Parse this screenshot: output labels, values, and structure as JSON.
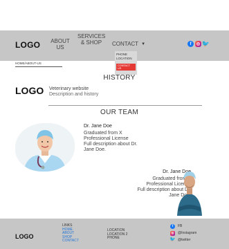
{
  "header": {
    "logo": "LOGO",
    "nav": {
      "about": "ABOUT US",
      "services": "SERVICES & SHOP",
      "contact": "CONTACT"
    },
    "social_icons": [
      "facebook-icon",
      "instagram-icon",
      "twitter-icon"
    ]
  },
  "dropdown": {
    "items": [
      "PHONE",
      "LOCATION"
    ],
    "button": "CONTACT US"
  },
  "breadcrumb": "HOME/ABOUT-US",
  "history": {
    "title": "HISTORY",
    "logo": "LOGO",
    "heading": "Veterinary website",
    "sub": "Description and history"
  },
  "team": {
    "title": "OUR TEAM",
    "member1": {
      "name": "Dr.  Jane Doe",
      "line1": "Graduated from X",
      "line2": "Professional License",
      "line3": "Full description about Dr.",
      "line4": "Jane Doe."
    },
    "member2": {
      "name": "Dr.  Jane Doe",
      "line1": "Graduated from X",
      "line2": "Professional License",
      "line3": "Full description about Dr.",
      "line4": "Jane Doe."
    }
  },
  "footer": {
    "logo": "LOGO",
    "links_title": "LINKS",
    "links": [
      "HOME",
      "ABOUT",
      "SHOP",
      "CONTACT"
    ],
    "location": [
      "LOCATION",
      "LOCATION 2",
      "PHONE"
    ],
    "social": {
      "fb": "FB",
      "instagram": "@Instagram",
      "twitter": "@twitter"
    }
  },
  "colors": {
    "bar_gray": "#c6c6c6",
    "accent_red": "#e53935",
    "link_blue": "#1e73d8"
  }
}
